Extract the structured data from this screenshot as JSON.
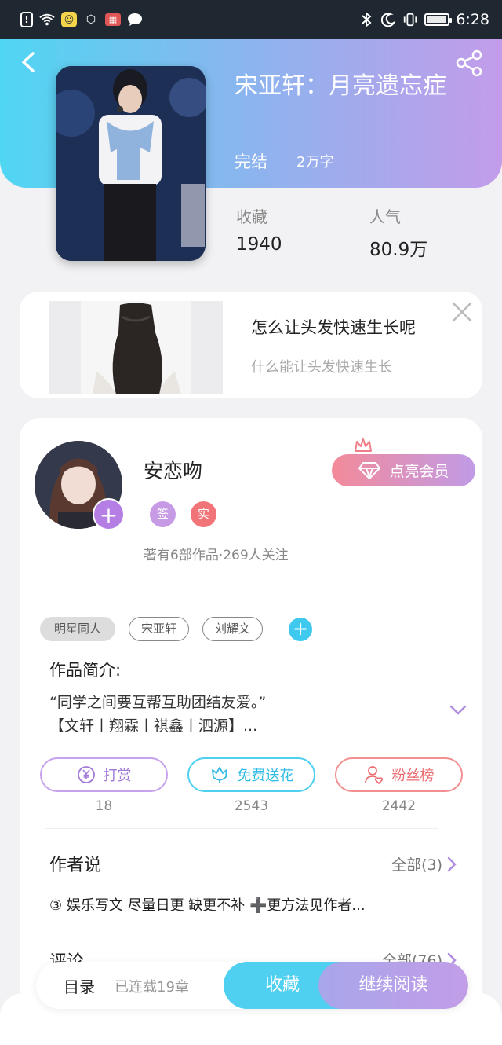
{
  "status_bar": {
    "time": "6:28",
    "left_icons": [
      "alert-icon",
      "wifi-icon",
      "app-icon",
      "settings-hex-icon",
      "calendar-icon",
      "chat-bubble-icon"
    ],
    "right_icons": [
      "bluetooth-icon",
      "moon-icon",
      "vibrate-icon",
      "battery-icon"
    ]
  },
  "book": {
    "title": "宋亚轩：月亮遗忘症",
    "status": "完结",
    "word_count": "2万字",
    "stats": [
      {
        "label": "收藏",
        "value": "1940"
      },
      {
        "label": "人气",
        "value": "80.9万"
      }
    ]
  },
  "ad": {
    "title": "怎么让头发快速生长呢",
    "subtitle": "什么能让头发快速生长"
  },
  "author": {
    "name": "安恋吻",
    "badges": [
      "签",
      "实"
    ],
    "stats": "著有6部作品·269人关注",
    "vip_button": "点亮会员"
  },
  "tags": [
    "明星同人",
    "宋亚轩",
    "刘耀文"
  ],
  "intro": {
    "heading": "作品简介:",
    "line1": "“同学之间要互帮互助团结友爱。”",
    "line2": "【文轩丨翔霖丨祺鑫丨泗源】..."
  },
  "actions": [
    {
      "label": "打赏",
      "count": "18"
    },
    {
      "label": "免费送花",
      "count": "2543"
    },
    {
      "label": "粉丝榜",
      "count": "2442"
    }
  ],
  "author_says": {
    "title": "作者说",
    "more": "全部(3)",
    "text": "③  娱乐写文 尽量日更 缺更不补 ➕更方法见作者..."
  },
  "comments": {
    "title": "评论",
    "more": "全部(76)"
  },
  "bottom_bar": {
    "toc": "目录",
    "serial": "已连载19章",
    "favorite": "收藏",
    "continue": "继续阅读"
  }
}
